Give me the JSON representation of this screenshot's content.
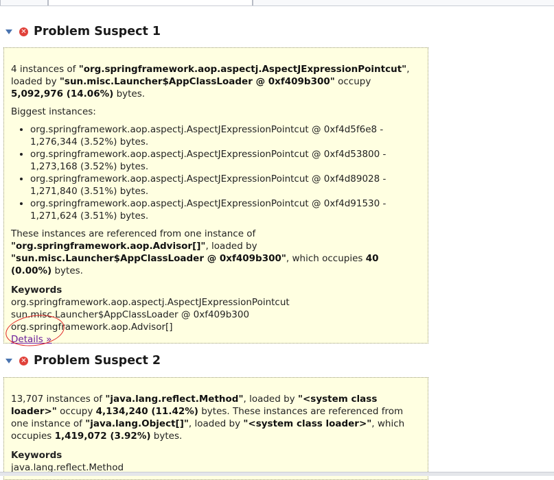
{
  "suspect1": {
    "title": "Problem Suspect 1",
    "p1_count": "4 instances of ",
    "p1_class": "\"org.springframework.aop.aspectj.AspectJExpressionPointcut\"",
    "p1_loaded": ", loaded by ",
    "p1_loader": "\"sun.misc.Launcher$AppClassLoader @ 0xf409b300\"",
    "p1_occupy": " occupy ",
    "p1_size": "5,092,976 (14.06%)",
    "p1_bytes": " bytes.",
    "biggest_label": "Biggest instances:",
    "instances": [
      "org.springframework.aop.aspectj.AspectJExpressionPointcut @ 0xf4d5f6e8 - 1,276,344 (3.52%) bytes.",
      "org.springframework.aop.aspectj.AspectJExpressionPointcut @ 0xf4d53800 - 1,273,168 (3.52%) bytes.",
      "org.springframework.aop.aspectj.AspectJExpressionPointcut @ 0xf4d89028 - 1,271,840 (3.51%) bytes.",
      "org.springframework.aop.aspectj.AspectJExpressionPointcut @ 0xf4d91530 - 1,271,624 (3.51%) bytes."
    ],
    "ref_text": "These instances are referenced from one instance of ",
    "ref_class": "\"org.springframework.aop.Advisor[]\"",
    "ref_loaded": ", loaded by ",
    "ref_loader": "\"sun.misc.Launcher$AppClassLoader @ 0xf409b300\"",
    "ref_which": ", which occupies ",
    "ref_size": "40 (0.00%)",
    "ref_bytes": " bytes.",
    "keywords_label": "Keywords",
    "keywords": [
      "org.springframework.aop.aspectj.AspectJExpressionPointcut",
      "sun.misc.Launcher$AppClassLoader @ 0xf409b300",
      "org.springframework.aop.Advisor[]"
    ],
    "details_link": "Details »"
  },
  "suspect2": {
    "title": "Problem Suspect 2",
    "p1_count": "13,707 instances of ",
    "p1_class": "\"java.lang.reflect.Method\"",
    "p1_loaded": ", loaded by ",
    "p1_loader": "\"<system class loader>\"",
    "p1_occupy": " occupy ",
    "p1_size": "4,134,240 (11.42%)",
    "p1_mid": " bytes. These instances are referenced from one instance of ",
    "p1_ref_class": "\"java.lang.Object[]\"",
    "p1_loaded2": ", loaded by ",
    "p1_loader2": "\"<system class loader>\"",
    "p1_which": ", which occupies ",
    "p1_ref_size": "1,419,072 (3.92%)",
    "p1_bytes": " bytes.",
    "keywords_label": "Keywords",
    "keywords": [
      "java.lang.reflect.Method"
    ]
  },
  "colors": {
    "panel_bg": "#ffffe1",
    "error_icon": "#e0413a",
    "link": "#6a1b9a",
    "annotation_circle": "#e02020"
  },
  "icons": {
    "toggle": "triangle-down-icon",
    "error": "error-icon"
  }
}
